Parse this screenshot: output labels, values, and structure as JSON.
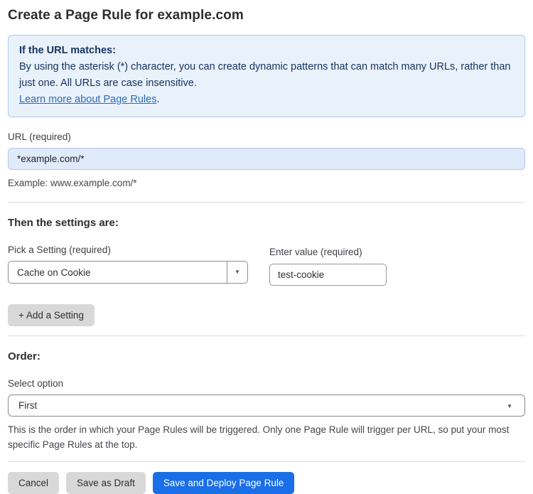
{
  "page": {
    "title": "Create a Page Rule for example.com"
  },
  "info_box": {
    "heading": "If the URL matches:",
    "body": "By using the asterisk (*) character, you can create dynamic patterns that can match many URLs, rather than just one. All URLs are case insensitive.",
    "link_label": "Learn more about Page Rules",
    "link_suffix": "."
  },
  "url_section": {
    "label": "URL (required)",
    "value": "*example.com/*",
    "example": "Example: www.example.com/*"
  },
  "settings_section": {
    "heading": "Then the settings are:",
    "setting_label": "Pick a Setting (required)",
    "setting_value": "Cache on Cookie",
    "value_label": "Enter value (required)",
    "value_input": "test-cookie",
    "add_button_label": "+ Add a Setting",
    "dropdown_caret": "▼"
  },
  "order_section": {
    "heading": "Order:",
    "label": "Select option",
    "selected_value": "First",
    "caret": "▼",
    "help": "This is the order in which your Page Rules will be triggered. Only one Page Rule will trigger per URL, so put your most specific Page Rules at the top."
  },
  "actions": {
    "cancel_label": "Cancel",
    "save_draft_label": "Save as Draft",
    "save_deploy_label": "Save and Deploy Page Rule"
  },
  "colors": {
    "info_background": "#e9f1fb",
    "info_border": "#a9c8ec",
    "info_text": "#15335e",
    "link": "#2d6cb5",
    "url_input_background": "#dfeafa",
    "primary_button": "#1a6ee8",
    "gray_button": "#d8d8d8"
  }
}
